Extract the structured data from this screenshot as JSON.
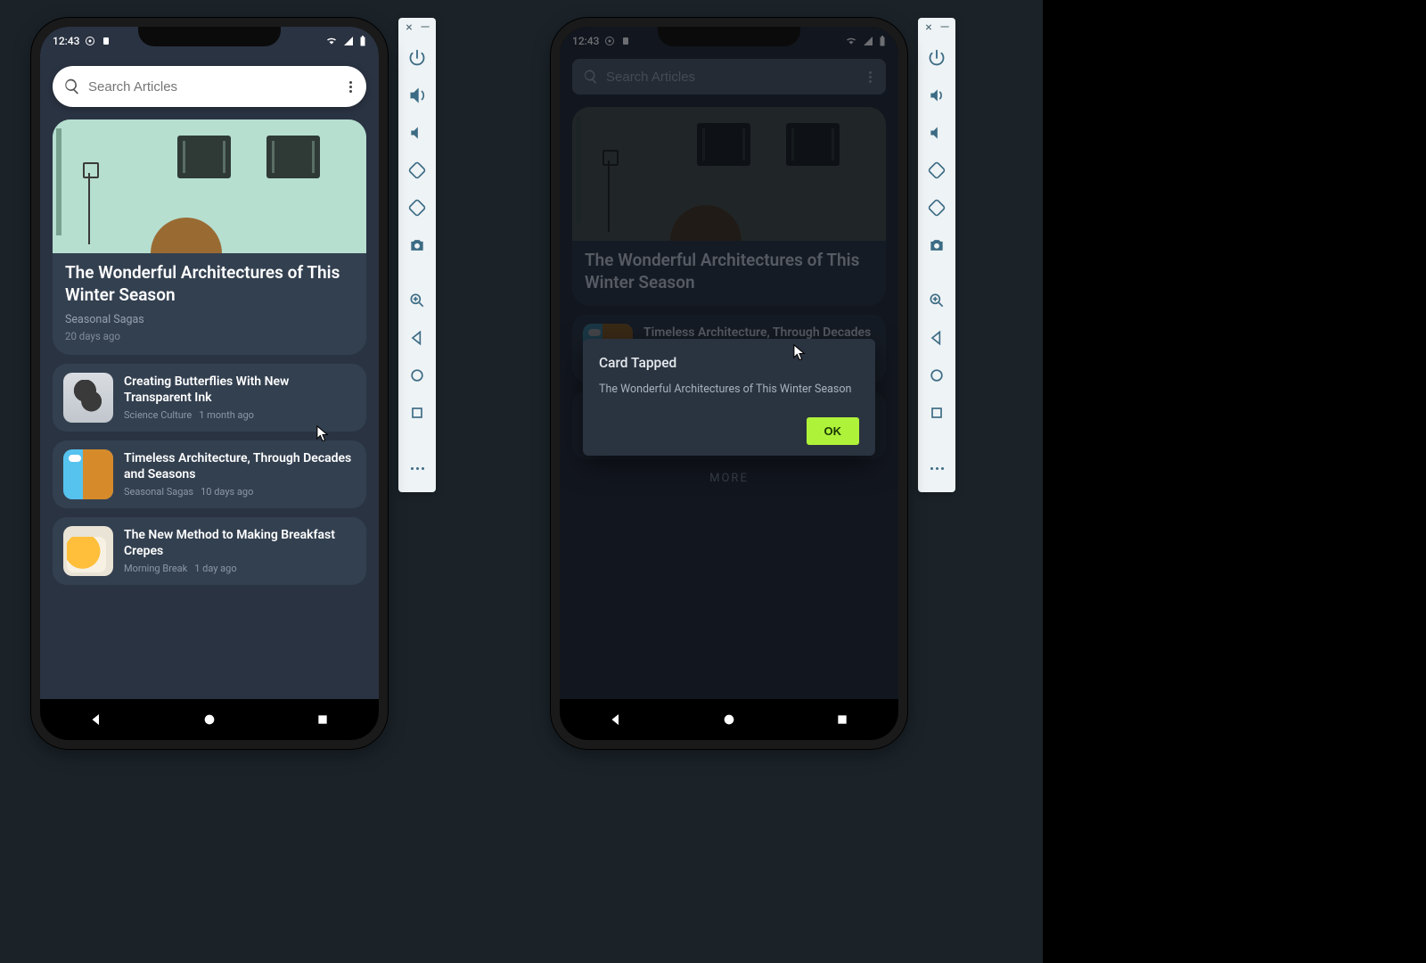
{
  "status": {
    "time": "12:43"
  },
  "search": {
    "placeholder": "Search Articles"
  },
  "hero": {
    "title": "The Wonderful Architectures of This Winter Season",
    "source": "Seasonal Sagas",
    "age": "20 days ago"
  },
  "cards": [
    {
      "title": "Creating Butterflies With New Transparent Ink",
      "source": "Science Culture",
      "age": "1 month ago"
    },
    {
      "title": "Timeless Architecture, Through Decades and Seasons",
      "source": "Seasonal Sagas",
      "age": "10 days ago"
    },
    {
      "title": "The New Method to Making Breakfast Crepes",
      "source": "Morning Break",
      "age": "1 day ago"
    }
  ],
  "more_label": "MORE",
  "dialog": {
    "title": "Card Tapped",
    "message": "The Wonderful Architectures of This Winter Season",
    "ok": "OK"
  },
  "hero2_title": "The Wonderful Architectures of This Winter Season"
}
